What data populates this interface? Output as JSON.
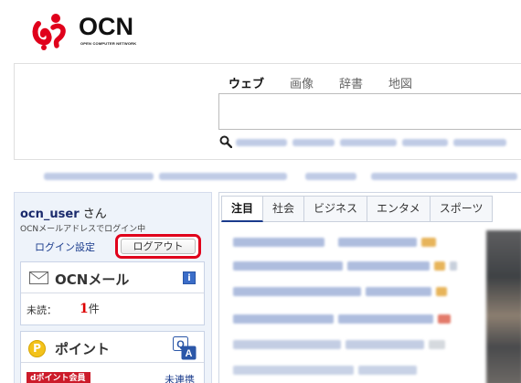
{
  "logo": {
    "text": "OCN",
    "subtext": "OPEN COMPUTER NETWORK",
    "colors": {
      "brand": "#e0001b"
    }
  },
  "search": {
    "tabs": [
      {
        "label": "ウェブ",
        "active": true
      },
      {
        "label": "画像",
        "active": false
      },
      {
        "label": "辞書",
        "active": false
      },
      {
        "label": "地図",
        "active": false
      }
    ],
    "value": "",
    "icon": "search-icon"
  },
  "user": {
    "name": "ocn_user",
    "suffix": "さん",
    "login_note": "OCNメールアドレスでログイン中",
    "login_settings_label": "ログイン設定",
    "logout_label": "ログアウト"
  },
  "mail": {
    "title": "OCNメール",
    "info_icon": "i",
    "unread_label": "未読：",
    "unread_count": "1",
    "unread_unit": "件"
  },
  "point": {
    "icon_letter": "P",
    "title": "ポイント",
    "banner": "dポイント会員",
    "unlinked_label": "未連携"
  },
  "news": {
    "tabs": [
      {
        "label": "注目",
        "active": true
      },
      {
        "label": "社会",
        "active": false
      },
      {
        "label": "ビジネス",
        "active": false
      },
      {
        "label": "エンタメ",
        "active": false
      },
      {
        "label": "スポーツ",
        "active": false
      }
    ]
  }
}
